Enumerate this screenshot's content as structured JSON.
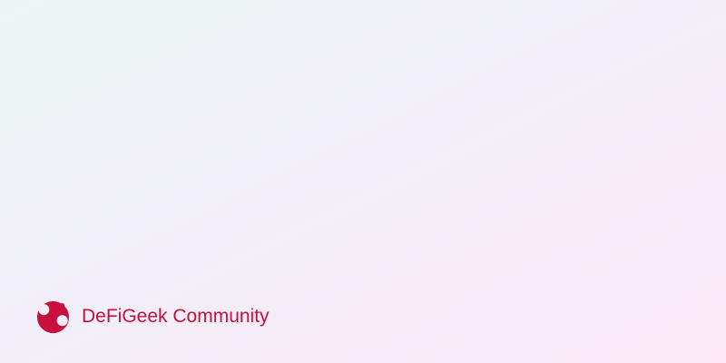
{
  "brand": {
    "name": "DeFiGeek Community",
    "logo_icon": "defigeek-logo-icon",
    "color": "#c8103e"
  },
  "background": {
    "gradient": [
      "#ebf6f4",
      "#f1eff7",
      "#f6ebf6",
      "#fbe7f5"
    ]
  }
}
